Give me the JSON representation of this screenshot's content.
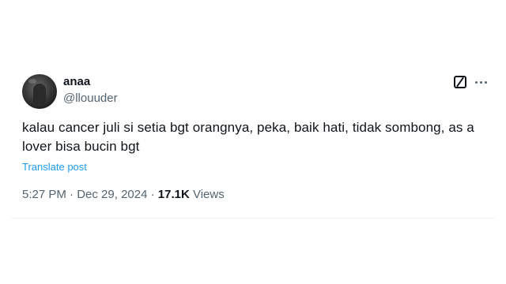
{
  "tweet": {
    "author": {
      "display_name": "anaa",
      "handle": "@llouuder"
    },
    "text": "kalau cancer juli si setia bgt orangnya, peka, baik hati, tidak sombong, as a lover bisa bucin bgt",
    "translate_label": "Translate post",
    "time": "5:27 PM",
    "separator": " · ",
    "date": "Dec 29, 2024",
    "views_count": "17.1K",
    "views_label": " Views"
  },
  "icons": {
    "grok": "grok-icon",
    "more": "more-icon"
  },
  "colors": {
    "link": "#1d9bf0",
    "secondary_text": "#536471",
    "primary_text": "#0f1419"
  }
}
